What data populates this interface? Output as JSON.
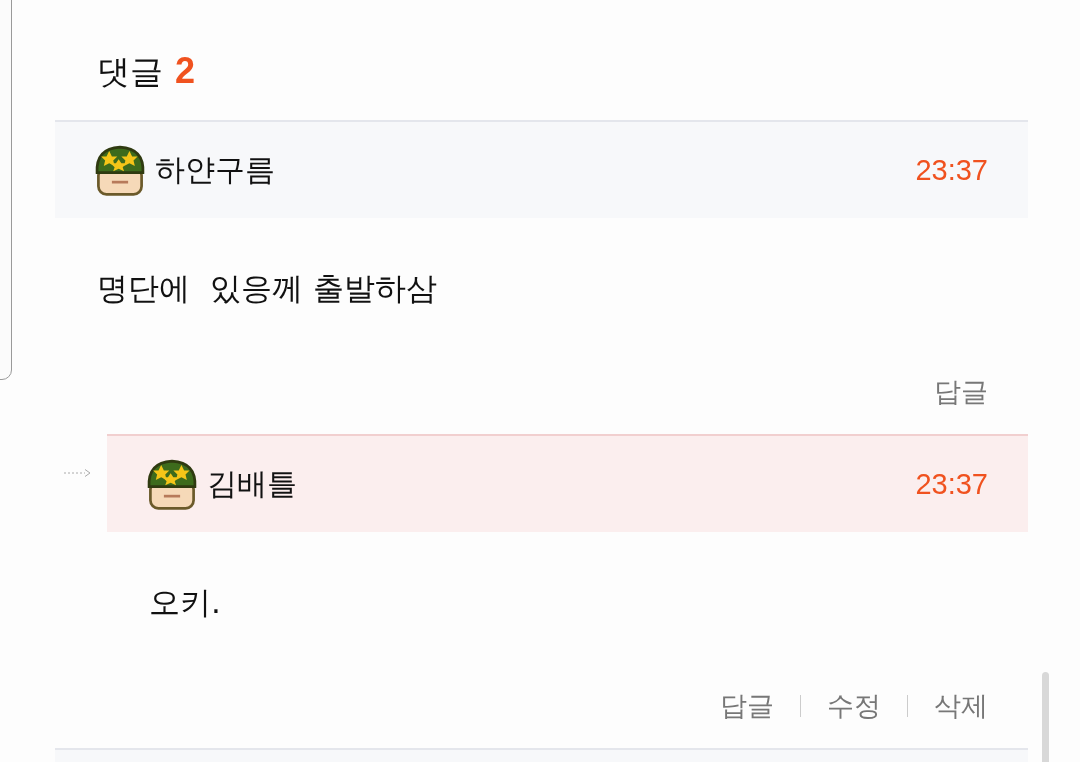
{
  "header": {
    "title": "댓글",
    "count": "2"
  },
  "comments": [
    {
      "kind": "comment",
      "author": "하얀구름",
      "time": "23:37",
      "text": "명단에  있응께 출발하삼",
      "actions": [
        "답글"
      ]
    },
    {
      "kind": "reply",
      "author": "김배틀",
      "time": "23:37",
      "text": "오키.",
      "actions": [
        "답글",
        "수정",
        "삭제"
      ]
    }
  ]
}
